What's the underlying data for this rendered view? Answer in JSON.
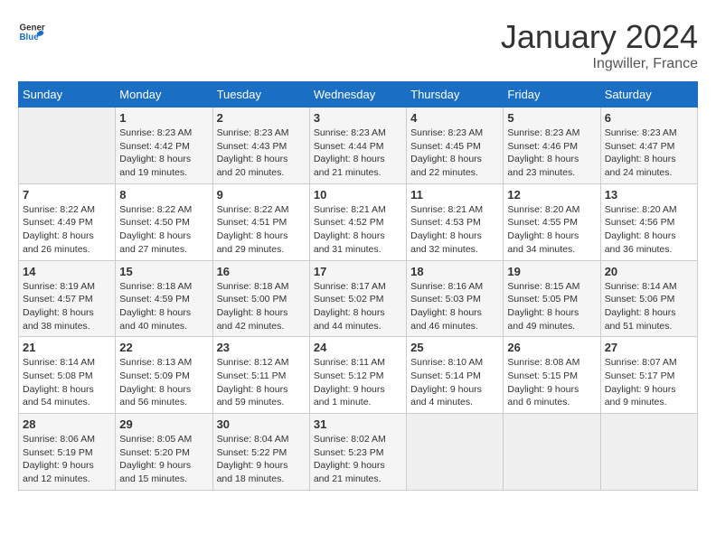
{
  "header": {
    "logo_general": "General",
    "logo_blue": "Blue",
    "month_year": "January 2024",
    "location": "Ingwiller, France"
  },
  "days_of_week": [
    "Sunday",
    "Monday",
    "Tuesday",
    "Wednesday",
    "Thursday",
    "Friday",
    "Saturday"
  ],
  "weeks": [
    [
      {
        "day": "",
        "sunrise": "",
        "sunset": "",
        "daylight": ""
      },
      {
        "day": "1",
        "sunrise": "Sunrise: 8:23 AM",
        "sunset": "Sunset: 4:42 PM",
        "daylight": "Daylight: 8 hours and 19 minutes."
      },
      {
        "day": "2",
        "sunrise": "Sunrise: 8:23 AM",
        "sunset": "Sunset: 4:43 PM",
        "daylight": "Daylight: 8 hours and 20 minutes."
      },
      {
        "day": "3",
        "sunrise": "Sunrise: 8:23 AM",
        "sunset": "Sunset: 4:44 PM",
        "daylight": "Daylight: 8 hours and 21 minutes."
      },
      {
        "day": "4",
        "sunrise": "Sunrise: 8:23 AM",
        "sunset": "Sunset: 4:45 PM",
        "daylight": "Daylight: 8 hours and 22 minutes."
      },
      {
        "day": "5",
        "sunrise": "Sunrise: 8:23 AM",
        "sunset": "Sunset: 4:46 PM",
        "daylight": "Daylight: 8 hours and 23 minutes."
      },
      {
        "day": "6",
        "sunrise": "Sunrise: 8:23 AM",
        "sunset": "Sunset: 4:47 PM",
        "daylight": "Daylight: 8 hours and 24 minutes."
      }
    ],
    [
      {
        "day": "7",
        "sunrise": "Sunrise: 8:22 AM",
        "sunset": "Sunset: 4:49 PM",
        "daylight": "Daylight: 8 hours and 26 minutes."
      },
      {
        "day": "8",
        "sunrise": "Sunrise: 8:22 AM",
        "sunset": "Sunset: 4:50 PM",
        "daylight": "Daylight: 8 hours and 27 minutes."
      },
      {
        "day": "9",
        "sunrise": "Sunrise: 8:22 AM",
        "sunset": "Sunset: 4:51 PM",
        "daylight": "Daylight: 8 hours and 29 minutes."
      },
      {
        "day": "10",
        "sunrise": "Sunrise: 8:21 AM",
        "sunset": "Sunset: 4:52 PM",
        "daylight": "Daylight: 8 hours and 31 minutes."
      },
      {
        "day": "11",
        "sunrise": "Sunrise: 8:21 AM",
        "sunset": "Sunset: 4:53 PM",
        "daylight": "Daylight: 8 hours and 32 minutes."
      },
      {
        "day": "12",
        "sunrise": "Sunrise: 8:20 AM",
        "sunset": "Sunset: 4:55 PM",
        "daylight": "Daylight: 8 hours and 34 minutes."
      },
      {
        "day": "13",
        "sunrise": "Sunrise: 8:20 AM",
        "sunset": "Sunset: 4:56 PM",
        "daylight": "Daylight: 8 hours and 36 minutes."
      }
    ],
    [
      {
        "day": "14",
        "sunrise": "Sunrise: 8:19 AM",
        "sunset": "Sunset: 4:57 PM",
        "daylight": "Daylight: 8 hours and 38 minutes."
      },
      {
        "day": "15",
        "sunrise": "Sunrise: 8:18 AM",
        "sunset": "Sunset: 4:59 PM",
        "daylight": "Daylight: 8 hours and 40 minutes."
      },
      {
        "day": "16",
        "sunrise": "Sunrise: 8:18 AM",
        "sunset": "Sunset: 5:00 PM",
        "daylight": "Daylight: 8 hours and 42 minutes."
      },
      {
        "day": "17",
        "sunrise": "Sunrise: 8:17 AM",
        "sunset": "Sunset: 5:02 PM",
        "daylight": "Daylight: 8 hours and 44 minutes."
      },
      {
        "day": "18",
        "sunrise": "Sunrise: 8:16 AM",
        "sunset": "Sunset: 5:03 PM",
        "daylight": "Daylight: 8 hours and 46 minutes."
      },
      {
        "day": "19",
        "sunrise": "Sunrise: 8:15 AM",
        "sunset": "Sunset: 5:05 PM",
        "daylight": "Daylight: 8 hours and 49 minutes."
      },
      {
        "day": "20",
        "sunrise": "Sunrise: 8:14 AM",
        "sunset": "Sunset: 5:06 PM",
        "daylight": "Daylight: 8 hours and 51 minutes."
      }
    ],
    [
      {
        "day": "21",
        "sunrise": "Sunrise: 8:14 AM",
        "sunset": "Sunset: 5:08 PM",
        "daylight": "Daylight: 8 hours and 54 minutes."
      },
      {
        "day": "22",
        "sunrise": "Sunrise: 8:13 AM",
        "sunset": "Sunset: 5:09 PM",
        "daylight": "Daylight: 8 hours and 56 minutes."
      },
      {
        "day": "23",
        "sunrise": "Sunrise: 8:12 AM",
        "sunset": "Sunset: 5:11 PM",
        "daylight": "Daylight: 8 hours and 59 minutes."
      },
      {
        "day": "24",
        "sunrise": "Sunrise: 8:11 AM",
        "sunset": "Sunset: 5:12 PM",
        "daylight": "Daylight: 9 hours and 1 minute."
      },
      {
        "day": "25",
        "sunrise": "Sunrise: 8:10 AM",
        "sunset": "Sunset: 5:14 PM",
        "daylight": "Daylight: 9 hours and 4 minutes."
      },
      {
        "day": "26",
        "sunrise": "Sunrise: 8:08 AM",
        "sunset": "Sunset: 5:15 PM",
        "daylight": "Daylight: 9 hours and 6 minutes."
      },
      {
        "day": "27",
        "sunrise": "Sunrise: 8:07 AM",
        "sunset": "Sunset: 5:17 PM",
        "daylight": "Daylight: 9 hours and 9 minutes."
      }
    ],
    [
      {
        "day": "28",
        "sunrise": "Sunrise: 8:06 AM",
        "sunset": "Sunset: 5:19 PM",
        "daylight": "Daylight: 9 hours and 12 minutes."
      },
      {
        "day": "29",
        "sunrise": "Sunrise: 8:05 AM",
        "sunset": "Sunset: 5:20 PM",
        "daylight": "Daylight: 9 hours and 15 minutes."
      },
      {
        "day": "30",
        "sunrise": "Sunrise: 8:04 AM",
        "sunset": "Sunset: 5:22 PM",
        "daylight": "Daylight: 9 hours and 18 minutes."
      },
      {
        "day": "31",
        "sunrise": "Sunrise: 8:02 AM",
        "sunset": "Sunset: 5:23 PM",
        "daylight": "Daylight: 9 hours and 21 minutes."
      },
      {
        "day": "",
        "sunrise": "",
        "sunset": "",
        "daylight": ""
      },
      {
        "day": "",
        "sunrise": "",
        "sunset": "",
        "daylight": ""
      },
      {
        "day": "",
        "sunrise": "",
        "sunset": "",
        "daylight": ""
      }
    ]
  ]
}
